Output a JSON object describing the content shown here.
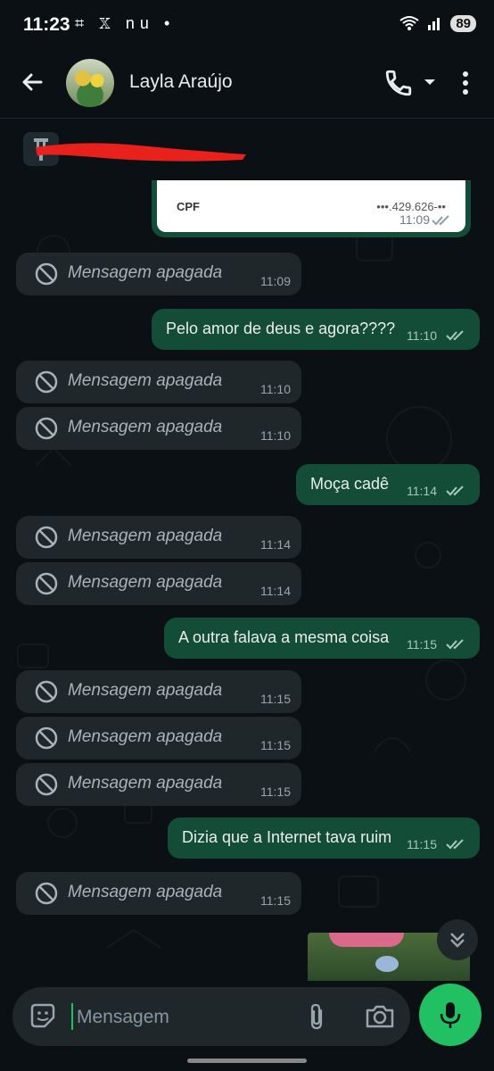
{
  "status_bar": {
    "time": "11:23",
    "left_icons": "⌗ 𝕏 nu •",
    "battery": "89"
  },
  "header": {
    "contact_name": "Layla Araújo"
  },
  "attachment": {
    "label": "CPF",
    "number": "•••.429.626-••",
    "time": "11:09",
    "status": "read"
  },
  "messages": [
    {
      "dir": "in",
      "deleted": true,
      "text": "Mensagem apagada",
      "time": "11:09"
    },
    {
      "dir": "out",
      "text": "Pelo amor de deus e agora????",
      "time": "11:10",
      "status": "read"
    },
    {
      "dir": "in",
      "deleted": true,
      "text": "Mensagem apagada",
      "time": "11:10"
    },
    {
      "dir": "in",
      "deleted": true,
      "text": "Mensagem apagada",
      "time": "11:10"
    },
    {
      "dir": "out",
      "text": "Moça cadê",
      "time": "11:14",
      "status": "read"
    },
    {
      "dir": "in",
      "deleted": true,
      "text": "Mensagem apagada",
      "time": "11:14"
    },
    {
      "dir": "in",
      "deleted": true,
      "text": "Mensagem apagada",
      "time": "11:14"
    },
    {
      "dir": "out",
      "text": "A outra falava a mesma coisa",
      "time": "11:15",
      "status": "read"
    },
    {
      "dir": "in",
      "deleted": true,
      "text": "Mensagem apagada",
      "time": "11:15"
    },
    {
      "dir": "in",
      "deleted": true,
      "text": "Mensagem apagada",
      "time": "11:15"
    },
    {
      "dir": "in",
      "deleted": true,
      "text": "Mensagem apagada",
      "time": "11:15"
    },
    {
      "dir": "out",
      "text": "Dizia que a Internet tava ruim",
      "time": "11:15",
      "status": "read"
    },
    {
      "dir": "in",
      "deleted": true,
      "text": "Mensagem apagada",
      "time": "11:15"
    }
  ],
  "composer": {
    "placeholder": "Mensagem"
  },
  "colors": {
    "accent": "#21c063",
    "outgoing": "#144d37",
    "incoming": "#1f272a",
    "background": "#0b1014"
  },
  "icons": [
    "back-arrow-icon",
    "phone-icon",
    "chevron-down-icon",
    "more-vert-icon",
    "pin-icon",
    "ban-icon",
    "double-check-icon",
    "scroll-down-icon",
    "sticker-icon",
    "attach-icon",
    "camera-icon",
    "mic-icon"
  ]
}
